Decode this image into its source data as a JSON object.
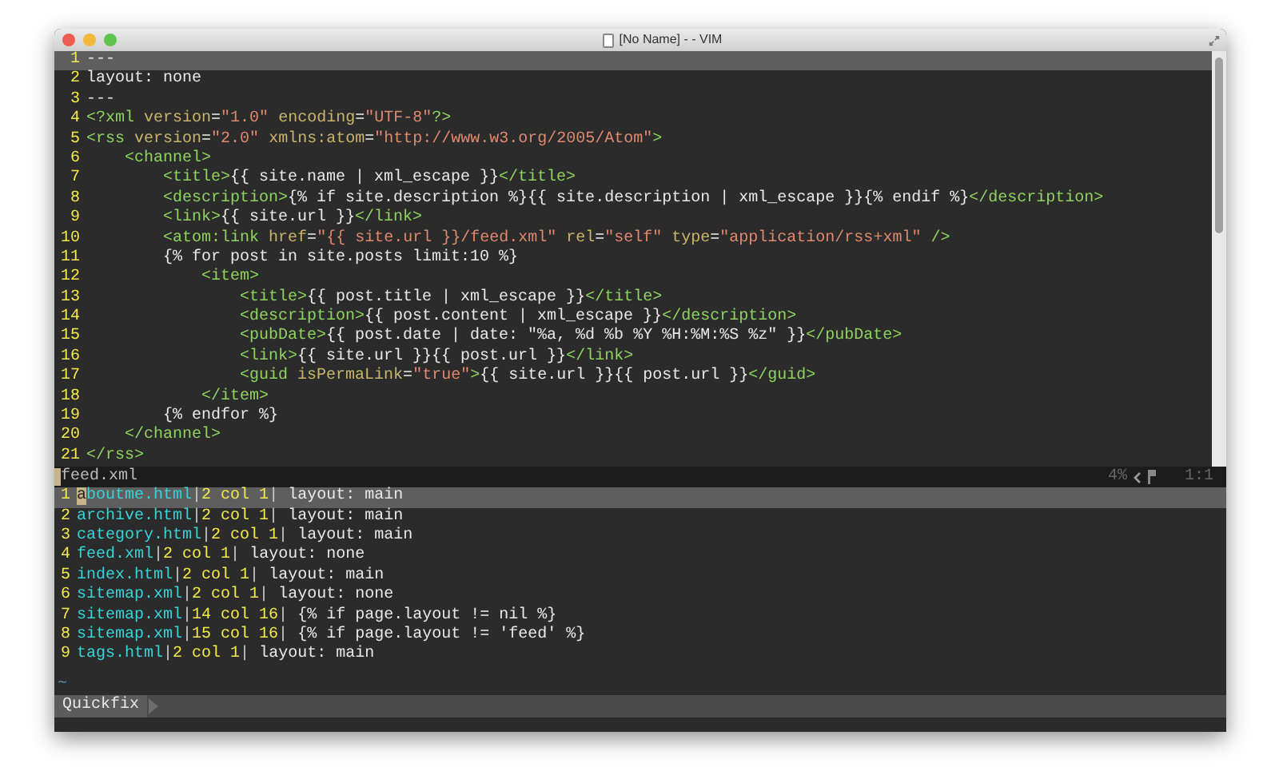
{
  "window": {
    "title": "[No Name] - - VIM"
  },
  "editor": {
    "lines": [
      {
        "number": "1",
        "current": true,
        "segments": [
          {
            "kind": "plain",
            "text": "---"
          }
        ]
      },
      {
        "number": "2",
        "current": false,
        "segments": [
          {
            "kind": "plain",
            "text": "layout: none"
          }
        ]
      },
      {
        "number": "3",
        "current": false,
        "segments": [
          {
            "kind": "plain",
            "text": "---"
          }
        ]
      },
      {
        "number": "4",
        "current": false,
        "segments": [
          {
            "kind": "tag",
            "text": "<?xml"
          },
          {
            "kind": "attr",
            "text": " version"
          },
          {
            "kind": "plain",
            "text": "="
          },
          {
            "kind": "string",
            "text": "\"1.0\""
          },
          {
            "kind": "attr",
            "text": " encoding"
          },
          {
            "kind": "plain",
            "text": "="
          },
          {
            "kind": "string",
            "text": "\"UTF-8\""
          },
          {
            "kind": "tag",
            "text": "?>"
          }
        ]
      },
      {
        "number": "5",
        "current": false,
        "segments": [
          {
            "kind": "tag",
            "text": "<rss"
          },
          {
            "kind": "attr",
            "text": " version"
          },
          {
            "kind": "plain",
            "text": "="
          },
          {
            "kind": "string",
            "text": "\"2.0\""
          },
          {
            "kind": "attr",
            "text": " xmlns:atom"
          },
          {
            "kind": "plain",
            "text": "="
          },
          {
            "kind": "string",
            "text": "\"http://www.w3.org/2005/Atom\""
          },
          {
            "kind": "tag",
            "text": ">"
          }
        ]
      },
      {
        "number": "6",
        "current": false,
        "segments": [
          {
            "kind": "tag",
            "text": "    <channel>"
          }
        ]
      },
      {
        "number": "7",
        "current": false,
        "segments": [
          {
            "kind": "tag",
            "text": "        <title>"
          },
          {
            "kind": "plain",
            "text": "{{ site.name | xml_escape }}"
          },
          {
            "kind": "tag",
            "text": "</title>"
          }
        ]
      },
      {
        "number": "8",
        "current": false,
        "segments": [
          {
            "kind": "tag",
            "text": "        <description>"
          },
          {
            "kind": "plain",
            "text": "{% if site.description %}{{ site.description | xml_escape }}{% endif %}"
          },
          {
            "kind": "tag",
            "text": "</description>"
          }
        ]
      },
      {
        "number": "9",
        "current": false,
        "segments": [
          {
            "kind": "tag",
            "text": "        <link>"
          },
          {
            "kind": "plain",
            "text": "{{ site.url }}"
          },
          {
            "kind": "tag",
            "text": "</link>"
          }
        ]
      },
      {
        "number": "10",
        "current": false,
        "segments": [
          {
            "kind": "tag",
            "text": "        <atom:link"
          },
          {
            "kind": "attr",
            "text": " href"
          },
          {
            "kind": "plain",
            "text": "="
          },
          {
            "kind": "string",
            "text": "\"{{ site.url }}/feed.xml\""
          },
          {
            "kind": "attr",
            "text": " rel"
          },
          {
            "kind": "plain",
            "text": "="
          },
          {
            "kind": "string",
            "text": "\"self\""
          },
          {
            "kind": "attr",
            "text": " type"
          },
          {
            "kind": "plain",
            "text": "="
          },
          {
            "kind": "string",
            "text": "\"application/rss+xml\""
          },
          {
            "kind": "tag",
            "text": " />"
          }
        ]
      },
      {
        "number": "11",
        "current": false,
        "segments": [
          {
            "kind": "plain",
            "text": "        {% for post in site.posts limit:10 %}"
          }
        ]
      },
      {
        "number": "12",
        "current": false,
        "segments": [
          {
            "kind": "tag",
            "text": "            <item>"
          }
        ]
      },
      {
        "number": "13",
        "current": false,
        "segments": [
          {
            "kind": "tag",
            "text": "                <title>"
          },
          {
            "kind": "plain",
            "text": "{{ post.title | xml_escape }}"
          },
          {
            "kind": "tag",
            "text": "</title>"
          }
        ]
      },
      {
        "number": "14",
        "current": false,
        "segments": [
          {
            "kind": "tag",
            "text": "                <description>"
          },
          {
            "kind": "plain",
            "text": "{{ post.content | xml_escape }}"
          },
          {
            "kind": "tag",
            "text": "</description>"
          }
        ]
      },
      {
        "number": "15",
        "current": false,
        "segments": [
          {
            "kind": "tag",
            "text": "                <pubDate>"
          },
          {
            "kind": "plain",
            "text": "{{ post.date | date: \"%a, %d %b %Y %H:%M:%S %z\" }}"
          },
          {
            "kind": "tag",
            "text": "</pubDate>"
          }
        ]
      },
      {
        "number": "16",
        "current": false,
        "segments": [
          {
            "kind": "tag",
            "text": "                <link>"
          },
          {
            "kind": "plain",
            "text": "{{ site.url }}{{ post.url }}"
          },
          {
            "kind": "tag",
            "text": "</link>"
          }
        ]
      },
      {
        "number": "17",
        "current": false,
        "segments": [
          {
            "kind": "tag",
            "text": "                <guid"
          },
          {
            "kind": "attr",
            "text": " isPermaLink"
          },
          {
            "kind": "plain",
            "text": "="
          },
          {
            "kind": "string",
            "text": "\"true\""
          },
          {
            "kind": "tag",
            "text": ">"
          },
          {
            "kind": "plain",
            "text": "{{ site.url }}{{ post.url }}"
          },
          {
            "kind": "tag",
            "text": "</guid>"
          }
        ]
      },
      {
        "number": "18",
        "current": false,
        "segments": [
          {
            "kind": "tag",
            "text": "            </item>"
          }
        ]
      },
      {
        "number": "19",
        "current": false,
        "segments": [
          {
            "kind": "plain",
            "text": "        {% endfor %}"
          }
        ]
      },
      {
        "number": "20",
        "current": false,
        "segments": [
          {
            "kind": "tag",
            "text": "    </channel>"
          }
        ]
      },
      {
        "number": "21",
        "current": false,
        "segments": [
          {
            "kind": "tag",
            "text": "</rss>"
          }
        ]
      }
    ]
  },
  "status_line": {
    "file": "feed.xml",
    "percent": "4%",
    "position": "1:1"
  },
  "quickfix": {
    "separator": "|",
    "entries": [
      {
        "number": "1",
        "file": "aboutme.html",
        "location": "2 col 1",
        "text": " layout: main",
        "selected": true
      },
      {
        "number": "2",
        "file": "archive.html",
        "location": "2 col 1",
        "text": " layout: main",
        "selected": false
      },
      {
        "number": "3",
        "file": "category.html",
        "location": "2 col 1",
        "text": " layout: main",
        "selected": false
      },
      {
        "number": "4",
        "file": "feed.xml",
        "location": "2 col 1",
        "text": " layout: none",
        "selected": false
      },
      {
        "number": "5",
        "file": "index.html",
        "location": "2 col 1",
        "text": " layout: main",
        "selected": false
      },
      {
        "number": "6",
        "file": "sitemap.xml",
        "location": "2 col 1",
        "text": " layout: none",
        "selected": false
      },
      {
        "number": "7",
        "file": "sitemap.xml",
        "location": "14 col 16",
        "text": " {% if page.layout != nil %}",
        "selected": false
      },
      {
        "number": "8",
        "file": "sitemap.xml",
        "location": "15 col 16",
        "text": " {% if page.layout != 'feed' %}",
        "selected": false
      },
      {
        "number": "9",
        "file": "tags.html",
        "location": "2 col 1",
        "text": " layout: main",
        "selected": false
      }
    ],
    "empty_line": "~",
    "tab_label": "Quickfix"
  }
}
